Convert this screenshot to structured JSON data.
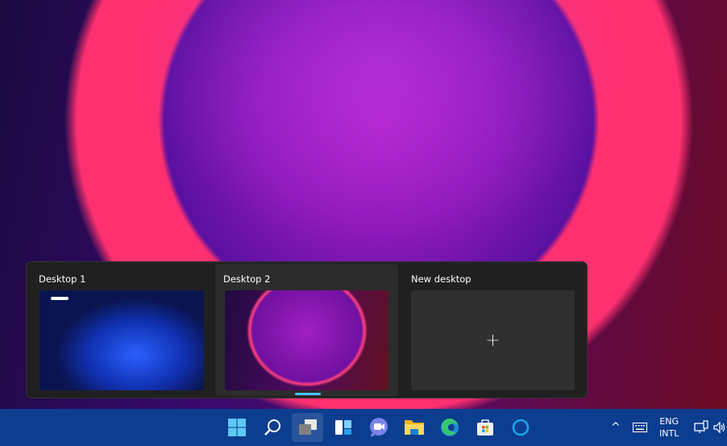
{
  "task_view": {
    "desktops": [
      {
        "label": "Desktop 1",
        "selected": false
      },
      {
        "label": "Desktop 2",
        "selected": true,
        "current": true
      }
    ],
    "new_desktop": {
      "label": "New desktop",
      "icon": "plus-icon",
      "symbol": "+"
    }
  },
  "taskbar": {
    "apps": [
      "start-icon",
      "search-icon",
      "task-view-icon",
      "widgets-icon",
      "teams-chat-icon",
      "file-explorer-icon",
      "edge-icon",
      "store-icon",
      "cortana-icon"
    ],
    "active": "task-view-icon",
    "color": "#0c3d8f",
    "tray": {
      "chevron": "^",
      "language_line1": "ENG",
      "language_line2": "INTL"
    }
  }
}
